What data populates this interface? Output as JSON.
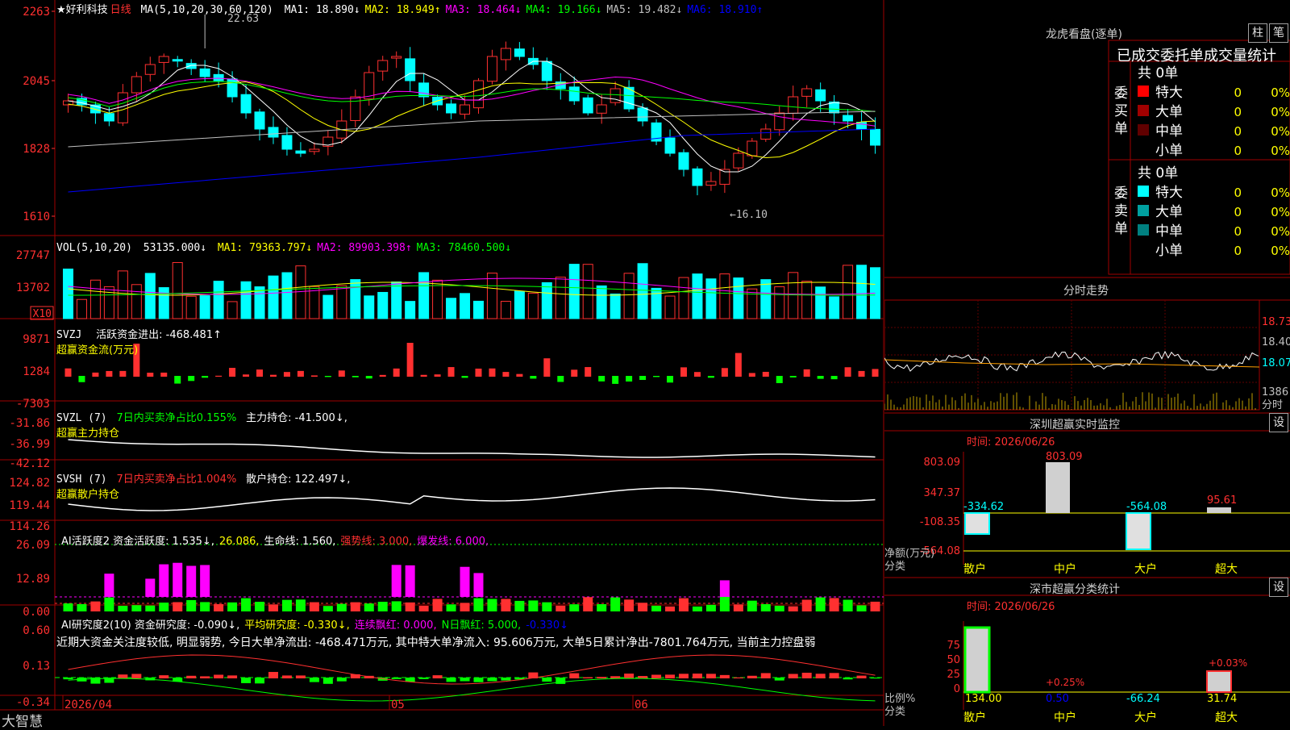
{
  "stock": {
    "name": "好利科技",
    "period": "日线",
    "ma_label": "MA(5,10,20,30,60,120)",
    "ma": [
      [
        "MA1: 18.890↓",
        "#ffffff"
      ],
      [
        "MA2: 18.949↑",
        "#ffff00"
      ],
      [
        "MA3: 18.464↓",
        "#ff00ff"
      ],
      [
        "MA4: 19.166↓",
        "#00ff00"
      ],
      [
        "MA5: 19.482↓",
        "#c0c0c0"
      ],
      [
        "MA6: 18.910↑",
        "#0000ff"
      ]
    ],
    "price_axis": [
      "2263",
      "2045",
      "1828",
      "1610"
    ],
    "high_label": "22.63",
    "low_label": "←16.10"
  },
  "vol": {
    "label": "VOL(5,10,20)",
    "value": "53135.000↓",
    "ma": [
      [
        "MA1: 79363.797↓",
        "#ffff00"
      ],
      [
        "MA2: 89903.398↑",
        "#ff00ff"
      ],
      [
        "MA3: 78460.500↓",
        "#00ff00"
      ]
    ],
    "axis": [
      "27747",
      "13702"
    ],
    "unit": "X10"
  },
  "svzj": {
    "label": "SVZJ",
    "text1": "活跃资金进出: -468.481↑",
    "text2": "超赢资金流(万元)",
    "axis": [
      "9871",
      "1284",
      "-7303"
    ]
  },
  "svzl": {
    "label": "SVZL (7)",
    "text1": "7日内买卖净占比0.155%",
    "text2": "主力持仓: -41.500↓,",
    "text3": "超赢主力持仓",
    "axis": [
      "-31.86",
      "-36.99",
      "-42.12"
    ]
  },
  "svsh": {
    "label": "SVSH (7)",
    "text1": "7日内买卖净占比1.004%",
    "text2": "散户持仓: 122.497↓,",
    "text3": "超赢散户持仓",
    "axis": [
      "124.82",
      "119.44",
      "114.26"
    ]
  },
  "ai1": {
    "items": [
      [
        "AI活跃度2 资金活跃度: 1.535↓,",
        "#ffffff"
      ],
      [
        "26.086,",
        "#ffff00"
      ],
      [
        "生命线: 1.560,",
        "#ffffff"
      ],
      [
        "强势线: 3.000,",
        "#ff3030"
      ],
      [
        "爆发线: 6.000,",
        "#ff00ff"
      ]
    ],
    "axis": [
      "26.09",
      "12.89",
      "0.00"
    ]
  },
  "ai2": {
    "items": [
      [
        "AI研究度2(10) 资金研究度: -0.090↓,",
        "#ffffff"
      ],
      [
        "平均研究度: -0.330↓,",
        "#ffff00"
      ],
      [
        "连续飘红: 0.000,",
        "#ff00ff"
      ],
      [
        "N日飘红: 5.000,",
        "#00ff00"
      ],
      [
        "-0.330↓",
        "#0000ff"
      ]
    ],
    "comment": "近期大资金关注度较低, 明显弱势, 今日大单净流出: -468.471万元, 其中特大单净流入: 95.606万元, 大单5日累计净出-7801.764万元, 当前主力控盘弱",
    "axis": [
      "0.60",
      "0.13",
      "-0.34"
    ]
  },
  "dates": [
    "2026/04",
    "05",
    "06"
  ],
  "brand": "大智慧",
  "right": {
    "lhkp": {
      "title": "龙虎看盘(逐单)",
      "btn1": "柱",
      "btn2": "笔",
      "subtitle": "已成交委托单成交量统计",
      "buy": {
        "side": "委买单",
        "total": "共 0单",
        "rows": [
          [
            "特大",
            "0",
            "0%",
            "#ff0000"
          ],
          [
            "大单",
            "0",
            "0%",
            "#a00000"
          ],
          [
            "中单",
            "0",
            "0%",
            "#600000"
          ],
          [
            "小单",
            "0",
            "0%",
            ""
          ]
        ]
      },
      "sell": {
        "side": "委卖单",
        "total": "共 0单",
        "rows": [
          [
            "特大",
            "0",
            "0%",
            "#00ffff"
          ],
          [
            "大单",
            "0",
            "0%",
            "#00a0a0"
          ],
          [
            "中单",
            "0",
            "0%",
            "#008080"
          ],
          [
            "小单",
            "0",
            "0%",
            ""
          ]
        ]
      }
    },
    "fenshi": {
      "title": "分时走势",
      "axis": [
        "18.73",
        "18.40",
        "18.07",
        "1386"
      ],
      "label": "分时"
    },
    "szmon": {
      "title": "深圳超赢实时监控",
      "btn": "设",
      "time": "时间: 2026/06/26",
      "axis": [
        "803.09",
        "347.37",
        "-108.35",
        "-564.08"
      ],
      "ylabel": "净额(万元)",
      "xlabel": "分类",
      "cats": [
        "散户",
        "中户",
        "大户",
        "超大"
      ],
      "values": [
        "-334.62",
        "803.09",
        "-564.08",
        "95.61"
      ]
    },
    "szcls": {
      "title": "深市超赢分类统计",
      "btn": "设",
      "time": "时间: 2026/06/26",
      "axis": [
        "75",
        "50",
        "25",
        "0"
      ],
      "ylabel": "比例%",
      "xlabel": "分类",
      "cats": [
        "散户",
        "中户",
        "大户",
        "超大"
      ],
      "pct": [
        "",
        "+0.25%",
        "",
        "+0.03%"
      ],
      "values": [
        "134.00",
        "0.50",
        "-66.24",
        "31.74"
      ]
    }
  },
  "chart_data": {
    "type": "candlestick",
    "ylim": [
      16.1,
      22.63
    ]
  }
}
